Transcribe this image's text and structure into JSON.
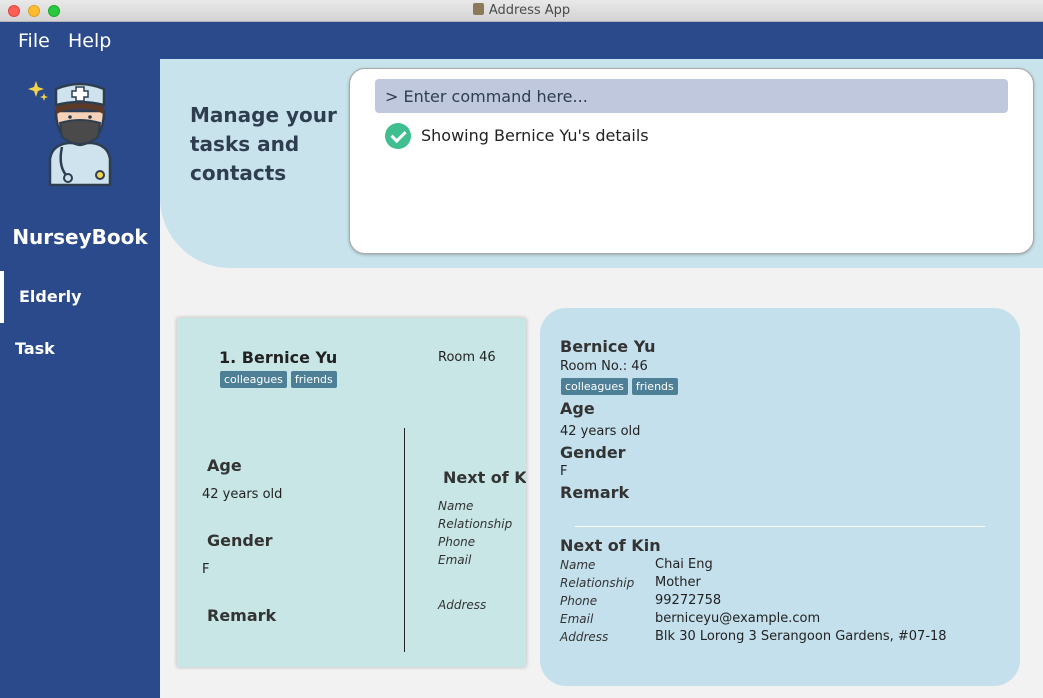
{
  "window": {
    "title": "Address App"
  },
  "menu": {
    "file": "File",
    "help": "Help"
  },
  "sidebar": {
    "brand": "NurseyBook",
    "items": [
      {
        "label": "Elderly",
        "active": true
      },
      {
        "label": "Task",
        "active": false
      }
    ]
  },
  "header": {
    "tagline": "Manage your tasks and contacts"
  },
  "command": {
    "placeholder": "> Enter command here...",
    "result": "Showing Bernice Yu's details",
    "result_icon": "check-circle-icon"
  },
  "list_card": {
    "name": "1. Bernice Yu",
    "room": "Room 46",
    "tags": [
      "colleagues",
      "friends"
    ],
    "age_label": "Age",
    "age_value": "42 years old",
    "gender_label": "Gender",
    "gender_value": "F",
    "remark_label": "Remark",
    "nok_title": "Next of Kin",
    "nok_fields": [
      "Name",
      "Relationship",
      "Phone",
      "Email",
      "Address"
    ]
  },
  "detail": {
    "name": "Bernice Yu",
    "room": "Room No.: 46",
    "tags": [
      "colleagues",
      "friends"
    ],
    "age_label": "Age",
    "age_value": "42 years old",
    "gender_label": "Gender",
    "gender_value": "F",
    "remark_label": "Remark",
    "nok_title": "Next of Kin",
    "nok": [
      {
        "field": "Name",
        "value": "Chai Eng"
      },
      {
        "field": "Relationship",
        "value": "Mother"
      },
      {
        "field": "Phone",
        "value": "99272758"
      },
      {
        "field": "Email",
        "value": "berniceyu@example.com"
      },
      {
        "field": "Address",
        "value": "Blk 30 Lorong 3 Serangoon Gardens, #07-18"
      }
    ]
  },
  "colors": {
    "nav": "#2b4a8b",
    "header": "#c9e3ec",
    "card": "#c8e6e5",
    "detail": "#c4e0ec",
    "tag": "#4d7f96",
    "success": "#3fbf8f"
  }
}
